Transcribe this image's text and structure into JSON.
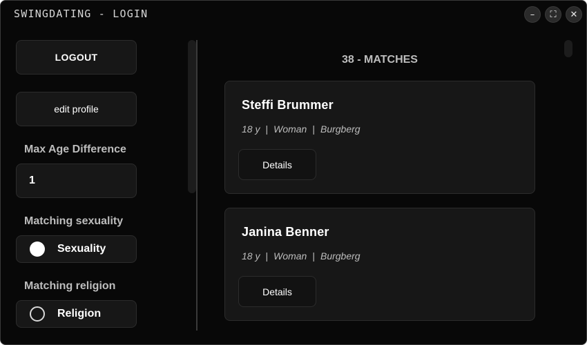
{
  "window": {
    "title": "SWINGDATING - LOGIN",
    "minimize_icon": "–",
    "maximize_icon": "⛶",
    "close_icon": "✕"
  },
  "sidebar": {
    "logout_label": "LOGOUT",
    "edit_profile_label": "edit profile",
    "max_age_label": "Max Age Difference",
    "max_age_value": "1",
    "sexuality_label": "Matching sexuality",
    "sexuality_option": "Sexuality",
    "sexuality_checked": true,
    "religion_label": "Matching religion",
    "religion_option": "Religion",
    "religion_checked": false
  },
  "main": {
    "matches_count": "38 - MATCHES",
    "meta_separator": "|",
    "matches": [
      {
        "name": "Steffi Brummer",
        "age": "18 y",
        "gender": "Woman",
        "city": "Burgberg",
        "details_label": "Details"
      },
      {
        "name": "Janina Benner",
        "age": "18 y",
        "gender": "Woman",
        "city": "Burgberg",
        "details_label": "Details"
      }
    ]
  },
  "colors": {
    "background": "#080808",
    "panel": "#171717",
    "border": "#2c2c2c",
    "text": "#ffffff",
    "muted_text": "#bdbdbd"
  }
}
